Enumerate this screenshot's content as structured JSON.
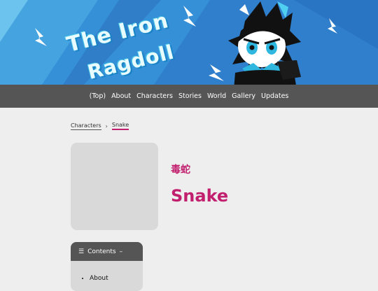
{
  "site": {
    "title_line1": "The Iron",
    "title_line2": "Ragdoll",
    "colors": {
      "banner": "#3a8fd6",
      "accent": "#c21e6e",
      "nav": "#555555"
    }
  },
  "nav": {
    "items": [
      {
        "label": "(Top)"
      },
      {
        "label": "About"
      },
      {
        "label": "Characters"
      },
      {
        "label": "Stories"
      },
      {
        "label": "World"
      },
      {
        "label": "Gallery"
      },
      {
        "label": "Updates"
      }
    ]
  },
  "breadcrumb": {
    "items": [
      {
        "label": "Characters"
      },
      {
        "label": "Snake"
      }
    ],
    "separator": "›"
  },
  "character": {
    "kanji": "毒蛇",
    "name": "Snake"
  },
  "toc": {
    "icon": "list-icon",
    "title": "Contents",
    "collapse_symbol": "–",
    "items": [
      {
        "label": "About"
      }
    ]
  }
}
